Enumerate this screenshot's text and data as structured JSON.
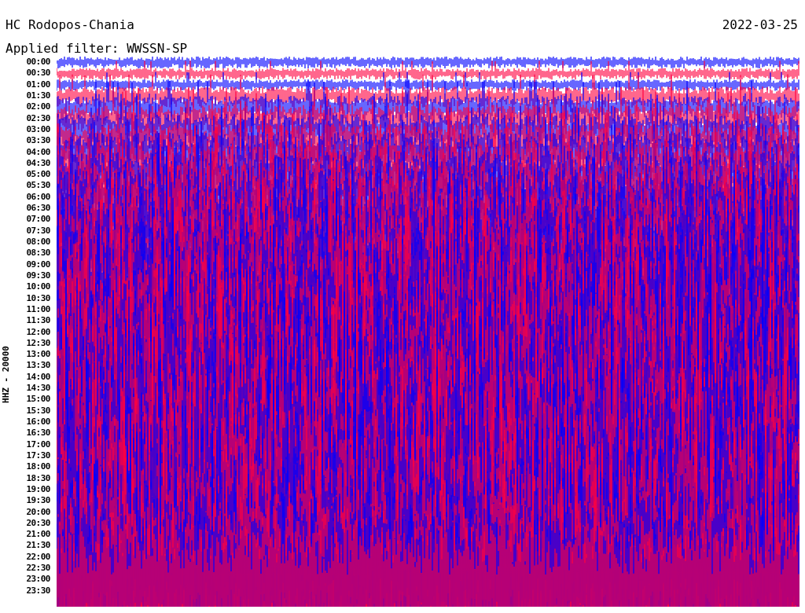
{
  "header": {
    "station": "HC Rodopos-Chania",
    "date": "2022-03-25",
    "filter": "Applied filter: WWSSN-SP"
  },
  "axis_label": "HHZ - 20000",
  "times": [
    "00:00",
    "00:30",
    "01:00",
    "01:30",
    "02:00",
    "02:30",
    "03:00",
    "03:30",
    "04:00",
    "04:30",
    "05:00",
    "05:30",
    "06:00",
    "06:30",
    "07:00",
    "07:30",
    "08:00",
    "08:30",
    "09:00",
    "09:30",
    "10:00",
    "10:30",
    "11:00",
    "11:30",
    "12:00",
    "12:30",
    "13:00",
    "13:30",
    "14:00",
    "14:30",
    "15:00",
    "15:30",
    "16:00",
    "16:30",
    "17:00",
    "17:30",
    "18:00",
    "18:30",
    "19:00",
    "19:30",
    "20:00",
    "20:30",
    "21:00",
    "21:30",
    "22:00",
    "22:30",
    "23:00",
    "23:30"
  ]
}
